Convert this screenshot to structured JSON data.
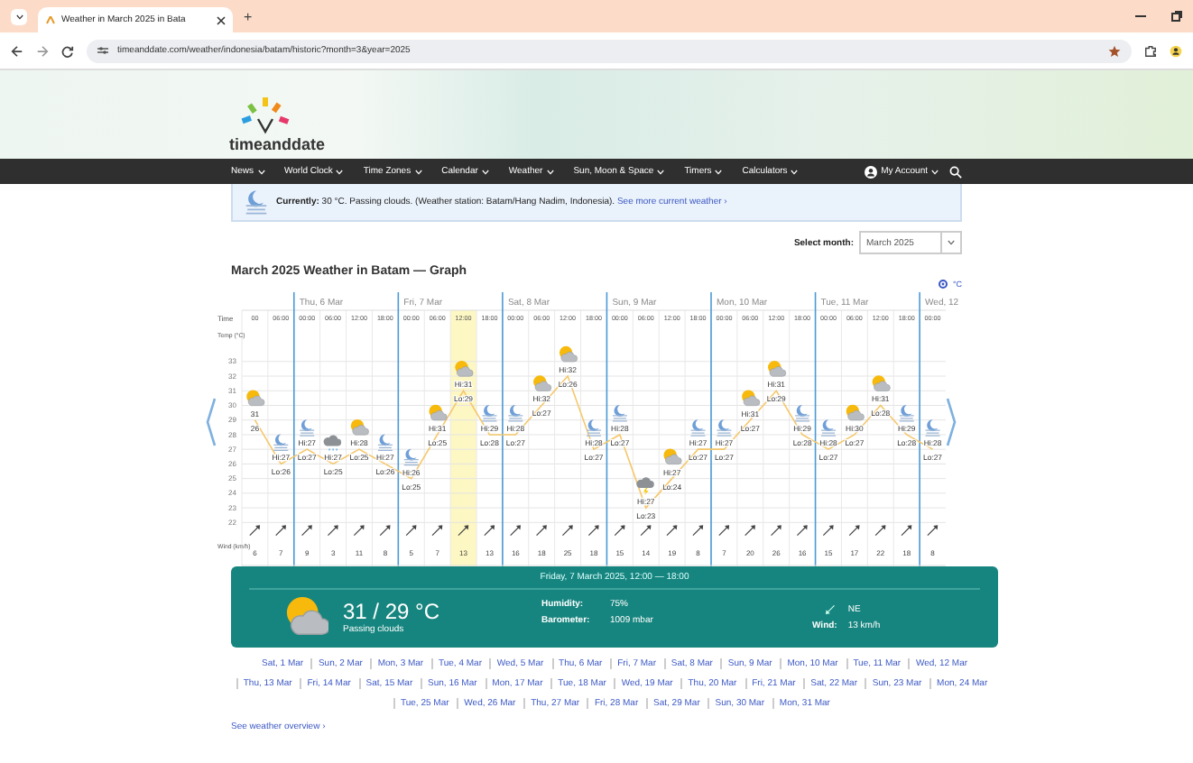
{
  "browser": {
    "tab_title": "Weather in March 2025 in Bata",
    "new_tab": "+",
    "address": "timeanddate.com/weather/indonesia/batam/historic?month=3&year=2025"
  },
  "site": {
    "logo": "timeanddate",
    "nav": [
      "News",
      "World Clock",
      "Time Zones",
      "Calendar",
      "Weather",
      "Sun, Moon & Space",
      "Timers",
      "Calculators"
    ],
    "account": "My Account"
  },
  "current": {
    "text": "**Currently:** 30 °C. Passing clouds. (Weather station: Batam/Hang Nadim, Indonesia).",
    "link": "See more current weather ›"
  },
  "month_select": {
    "label": "Select month:",
    "value": "March 2025"
  },
  "heading": "March 2025 Weather in Batam — Graph",
  "graph": {
    "unit_toggle": "°C",
    "row_labels": {
      "time": "Time",
      "wind": "Wind (km/h)"
    },
    "days": [
      {
        "columns": [
          {
            "time": "00",
            "kind": "sun_cloud",
            "high": "31",
            "low": "26",
            "wind": "6",
            "selected": false
          },
          {
            "time": "06:00",
            "kind": "moon_fog",
            "high": "Hi:27",
            "low": "Lo:26",
            "wind": "7",
            "selected": false
          }
        ]
      },
      {
        "label": "Thu, 6 Mar",
        "columns": [
          {
            "time": "00:00",
            "kind": "moon_fog",
            "high": "Hi:27",
            "low": "Lo:27",
            "wind": "9",
            "selected": false
          },
          {
            "time": "06:00",
            "kind": "cloud_rain",
            "high": "Hi:27",
            "low": "Lo:25",
            "wind": "3",
            "selected": false
          },
          {
            "time": "12:00",
            "kind": "sun_cloud",
            "high": "Hi:28",
            "low": "Lo:25",
            "wind": "11",
            "selected": false
          },
          {
            "time": "18:00",
            "kind": "moon_fog",
            "high": "Hi:27",
            "low": "Lo:26",
            "wind": "8",
            "selected": false
          }
        ]
      },
      {
        "label": "Fri, 7 Mar",
        "columns": [
          {
            "time": "00:00",
            "kind": "moon_fog",
            "high": "Hi:26",
            "low": "Lo:25",
            "wind": "5",
            "selected": false
          },
          {
            "time": "06:00",
            "kind": "sun_cloud",
            "high": "Hi:31",
            "low": "Lo:25",
            "wind": "7",
            "selected": false
          },
          {
            "time": "12:00",
            "kind": "sun_cloud",
            "high": "Hi:31",
            "low": "Lo:29",
            "wind": "13",
            "selected": true
          },
          {
            "time": "18:00",
            "kind": "moon_fog",
            "high": "Hi:29",
            "low": "Lo:28",
            "wind": "13",
            "selected": false
          }
        ]
      },
      {
        "label": "Sat, 8 Mar",
        "columns": [
          {
            "time": "00:00",
            "kind": "moon_fog",
            "high": "Hi:28",
            "low": "Lo:27",
            "wind": "16",
            "selected": false
          },
          {
            "time": "06:00",
            "kind": "sun_cloud",
            "high": "Hi:32",
            "low": "Lo:27",
            "wind": "18",
            "selected": false
          },
          {
            "time": "12:00",
            "kind": "sun_cloud",
            "high": "Hi:32",
            "low": "Lo:26",
            "wind": "25",
            "selected": false
          },
          {
            "time": "18:00",
            "kind": "moon_fog",
            "high": "Hi:28",
            "low": "Lo:27",
            "wind": "18",
            "selected": false
          }
        ]
      },
      {
        "label": "Sun, 9 Mar",
        "columns": [
          {
            "time": "00:00",
            "kind": "moon_fog",
            "high": "Hi:28",
            "low": "Lo:27",
            "wind": "15",
            "selected": false
          },
          {
            "time": "06:00",
            "kind": "cloud_thunder",
            "high": "Hi:27",
            "low": "Lo:23",
            "wind": "14",
            "selected": false
          },
          {
            "time": "12:00",
            "kind": "sun_cloud",
            "high": "Hi:27",
            "low": "Lo:24",
            "wind": "19",
            "selected": false
          },
          {
            "time": "18:00",
            "kind": "moon_fog",
            "high": "Hi:27",
            "low": "Lo:27",
            "wind": "8",
            "selected": false
          }
        ]
      },
      {
        "label": "Mon, 10 Mar",
        "columns": [
          {
            "time": "00:00",
            "kind": "moon_fog",
            "high": "Hi:27",
            "low": "Lo:27",
            "wind": "7",
            "selected": false
          },
          {
            "time": "06:00",
            "kind": "sun_cloud",
            "high": "Hi:31",
            "low": "Lo:27",
            "wind": "20",
            "selected": false
          },
          {
            "time": "12:00",
            "kind": "sun_cloud",
            "high": "Hi:31",
            "low": "Lo:29",
            "wind": "26",
            "selected": false
          },
          {
            "time": "18:00",
            "kind": "moon_fog",
            "high": "Hi:29",
            "low": "Lo:28",
            "wind": "16",
            "selected": false
          }
        ]
      },
      {
        "label": "Tue, 11 Mar",
        "columns": [
          {
            "time": "00:00",
            "kind": "moon_fog",
            "high": "Hi:28",
            "low": "Lo:27",
            "wind": "15",
            "selected": false
          },
          {
            "time": "06:00",
            "kind": "sun_cloud",
            "high": "Hi:30",
            "low": "Lo:27",
            "wind": "17",
            "selected": false
          },
          {
            "time": "12:00",
            "kind": "sun_cloud",
            "high": "Hi:31",
            "low": "Lo:28",
            "wind": "22",
            "selected": false
          },
          {
            "time": "18:00",
            "kind": "moon_fog",
            "high": "Hi:29",
            "low": "Lo:28",
            "wind": "18",
            "selected": false
          }
        ]
      },
      {
        "label": "Wed, 12",
        "columns": [
          {
            "time": "00:00",
            "kind": "moon_fog",
            "high": "Hi:28",
            "low": "Lo:27",
            "wind": "8",
            "selected": false
          }
        ]
      }
    ],
    "chart_data": {
      "type": "line",
      "ylabel": "Temp (°C)",
      "ylim": [
        19,
        36.5
      ],
      "grid": true,
      "yticks": [
        22,
        23,
        24,
        25,
        26,
        27,
        28,
        29,
        30,
        31,
        32,
        33
      ],
      "series": [
        {
          "color": "#f5c76a",
          "values": [
            29,
            26,
            27,
            26,
            27,
            26,
            25,
            28,
            31,
            28,
            28,
            30,
            32,
            27,
            28,
            23,
            25,
            27,
            27,
            29,
            31,
            28,
            27,
            28,
            30,
            28,
            27
          ]
        }
      ]
    }
  },
  "detail": {
    "period": "Friday, 7 March 2025, 12:00 — 18:00",
    "kind": "sun_cloud",
    "temperature": "31 / 29 °C",
    "condition": "Passing clouds",
    "humidity_label": "Humidity:",
    "humidity": "75%",
    "barometer_label": "Barometer:",
    "barometer": "1009 mbar",
    "wind_direction": "NE",
    "wind_label": "Wind:",
    "wind": "13 km/h"
  },
  "day_links": [
    "Sat, 1 Mar",
    "Sun, 2 Mar",
    "Mon, 3 Mar",
    "Tue, 4 Mar",
    "Wed, 5 Mar",
    "Thu, 6 Mar",
    "Fri, 7 Mar",
    "Sat, 8 Mar",
    "Sun, 9 Mar",
    "Mon, 10 Mar",
    "Tue, 11 Mar",
    "Wed, 12 Mar",
    "Thu, 13 Mar",
    "Fri, 14 Mar",
    "Sat, 15 Mar",
    "Sun, 16 Mar",
    "Mon, 17 Mar",
    "Tue, 18 Mar",
    "Wed, 19 Mar",
    "Thu, 20 Mar",
    "Fri, 21 Mar",
    "Sat, 22 Mar",
    "Sun, 23 Mar",
    "Mon, 24 Mar",
    "Tue, 25 Mar",
    "Wed, 26 Mar",
    "Thu, 27 Mar",
    "Fri, 28 Mar",
    "Sat, 29 Mar",
    "Sun, 30 Mar",
    "Mon, 31 Mar"
  ],
  "overview_link": "See weather overview ›"
}
